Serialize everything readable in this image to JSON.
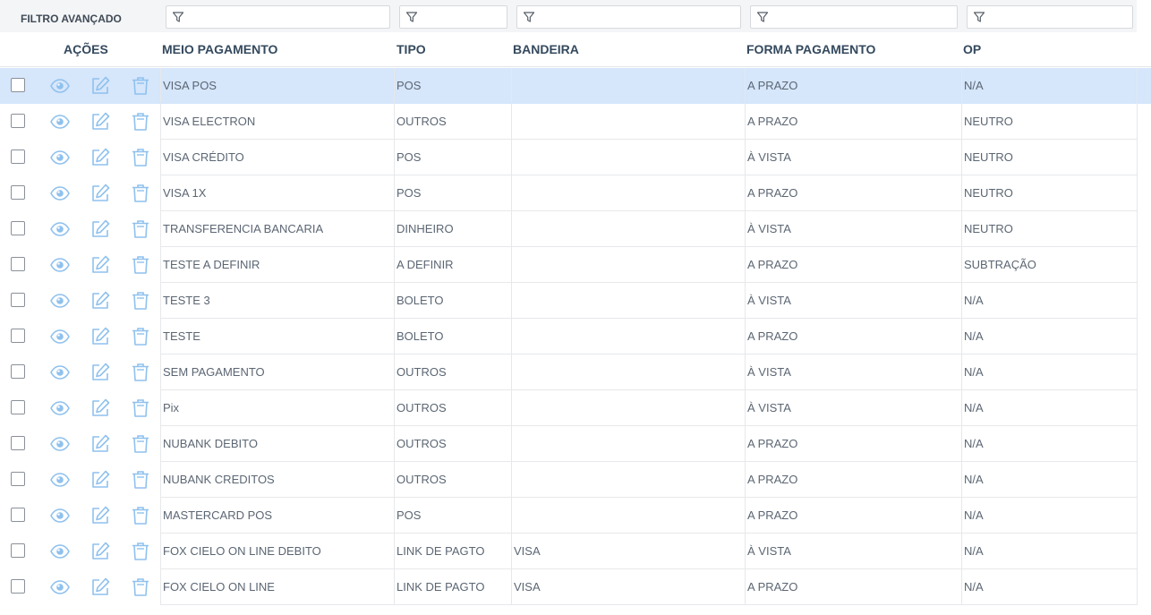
{
  "filter": {
    "title": "FILTRO AVANÇADO",
    "filter_icon": "filter-icon"
  },
  "headers": {
    "acoes": "AÇÕES",
    "meio_pagamento": "MEIO PAGAMENTO",
    "tipo": "TIPO",
    "bandeira": "BANDEIRA",
    "forma_pagamento": "FORMA PAGAMENTO",
    "op": "OP"
  },
  "icons": {
    "view": "eye-icon",
    "edit": "edit-icon",
    "delete": "trash-icon"
  },
  "colors": {
    "accent_icon": "#8fc1ee",
    "selected_row": "#d6e6fb",
    "header_text": "#34495e"
  },
  "rows": [
    {
      "meio": "VISA POS",
      "tipo": "POS",
      "bandeira": "",
      "forma": "A PRAZO",
      "op": "N/A",
      "selected": true
    },
    {
      "meio": "VISA ELECTRON",
      "tipo": "OUTROS",
      "bandeira": "",
      "forma": "A PRAZO",
      "op": "NEUTRO"
    },
    {
      "meio": "VISA CRÉDITO",
      "tipo": "POS",
      "bandeira": "",
      "forma": "À VISTA",
      "op": "NEUTRO"
    },
    {
      "meio": "VISA 1X",
      "tipo": "POS",
      "bandeira": "",
      "forma": "A PRAZO",
      "op": "NEUTRO"
    },
    {
      "meio": "TRANSFERENCIA BANCARIA",
      "tipo": "DINHEIRO",
      "bandeira": "",
      "forma": "À VISTA",
      "op": "NEUTRO"
    },
    {
      "meio": "TESTE A DEFINIR",
      "tipo": "A DEFINIR",
      "bandeira": "",
      "forma": "A PRAZO",
      "op": "SUBTRAÇÃO"
    },
    {
      "meio": "TESTE 3",
      "tipo": "BOLETO",
      "bandeira": "",
      "forma": "À VISTA",
      "op": "N/A"
    },
    {
      "meio": "TESTE",
      "tipo": "BOLETO",
      "bandeira": "",
      "forma": "A PRAZO",
      "op": "N/A"
    },
    {
      "meio": "SEM PAGAMENTO",
      "tipo": "OUTROS",
      "bandeira": "",
      "forma": "À VISTA",
      "op": "N/A"
    },
    {
      "meio": "Pix",
      "tipo": "OUTROS",
      "bandeira": "",
      "forma": "À VISTA",
      "op": "N/A"
    },
    {
      "meio": "NUBANK DEBITO",
      "tipo": "OUTROS",
      "bandeira": "",
      "forma": "A PRAZO",
      "op": "N/A"
    },
    {
      "meio": "NUBANK CREDITOS",
      "tipo": "OUTROS",
      "bandeira": "",
      "forma": "A PRAZO",
      "op": "N/A"
    },
    {
      "meio": "MASTERCARD POS",
      "tipo": "POS",
      "bandeira": "",
      "forma": "A PRAZO",
      "op": "N/A"
    },
    {
      "meio": "FOX CIELO ON LINE DEBITO",
      "tipo": "LINK DE PAGTO",
      "bandeira": "VISA",
      "forma": "À VISTA",
      "op": "N/A"
    },
    {
      "meio": "FOX CIELO ON LINE",
      "tipo": "LINK DE PAGTO",
      "bandeira": "VISA",
      "forma": "A PRAZO",
      "op": "N/A"
    }
  ]
}
